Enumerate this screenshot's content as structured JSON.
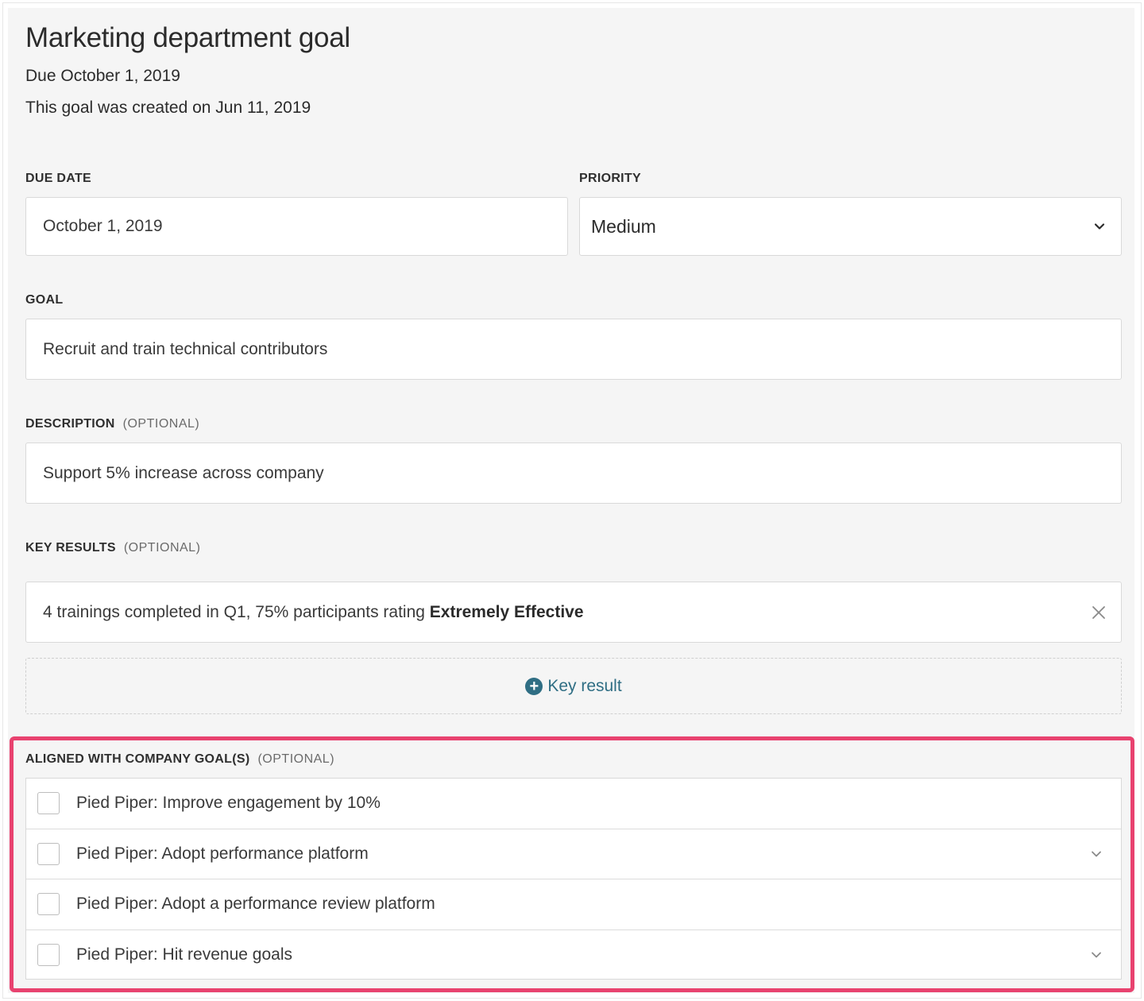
{
  "header": {
    "title": "Marketing department goal",
    "due_line": "Due October 1, 2019",
    "created_line": "This goal was created on Jun 11, 2019"
  },
  "due_date": {
    "label": "DUE DATE",
    "value": "October 1, 2019"
  },
  "priority": {
    "label": "PRIORITY",
    "value": "Medium"
  },
  "goal": {
    "label": "GOAL",
    "value": "Recruit and train technical contributors"
  },
  "description": {
    "label": "DESCRIPTION",
    "optional": "(OPTIONAL)",
    "value": "Support 5% increase across company"
  },
  "key_results": {
    "label": "KEY RESULTS",
    "optional": "(OPTIONAL)",
    "items": [
      {
        "text": "4 trainings completed in Q1, 75% participants rating ",
        "bold": "Extremely Effective"
      }
    ],
    "add_label": "Key result"
  },
  "aligned": {
    "label": "ALIGNED WITH COMPANY GOAL(S)",
    "optional": "(OPTIONAL)",
    "goals": [
      {
        "label": "Pied Piper: Improve engagement by 10%",
        "checked": false,
        "expandable": false
      },
      {
        "label": "Pied Piper: Adopt performance platform",
        "checked": false,
        "expandable": true
      },
      {
        "label": "Pied Piper: Adopt a performance review platform",
        "checked": false,
        "expandable": false
      },
      {
        "label": "Pied Piper: Hit revenue goals",
        "checked": false,
        "expandable": true
      }
    ]
  },
  "colors": {
    "accent": "#2f6e84",
    "highlight": "#e8426f",
    "panel_bg": "#f5f5f5"
  }
}
